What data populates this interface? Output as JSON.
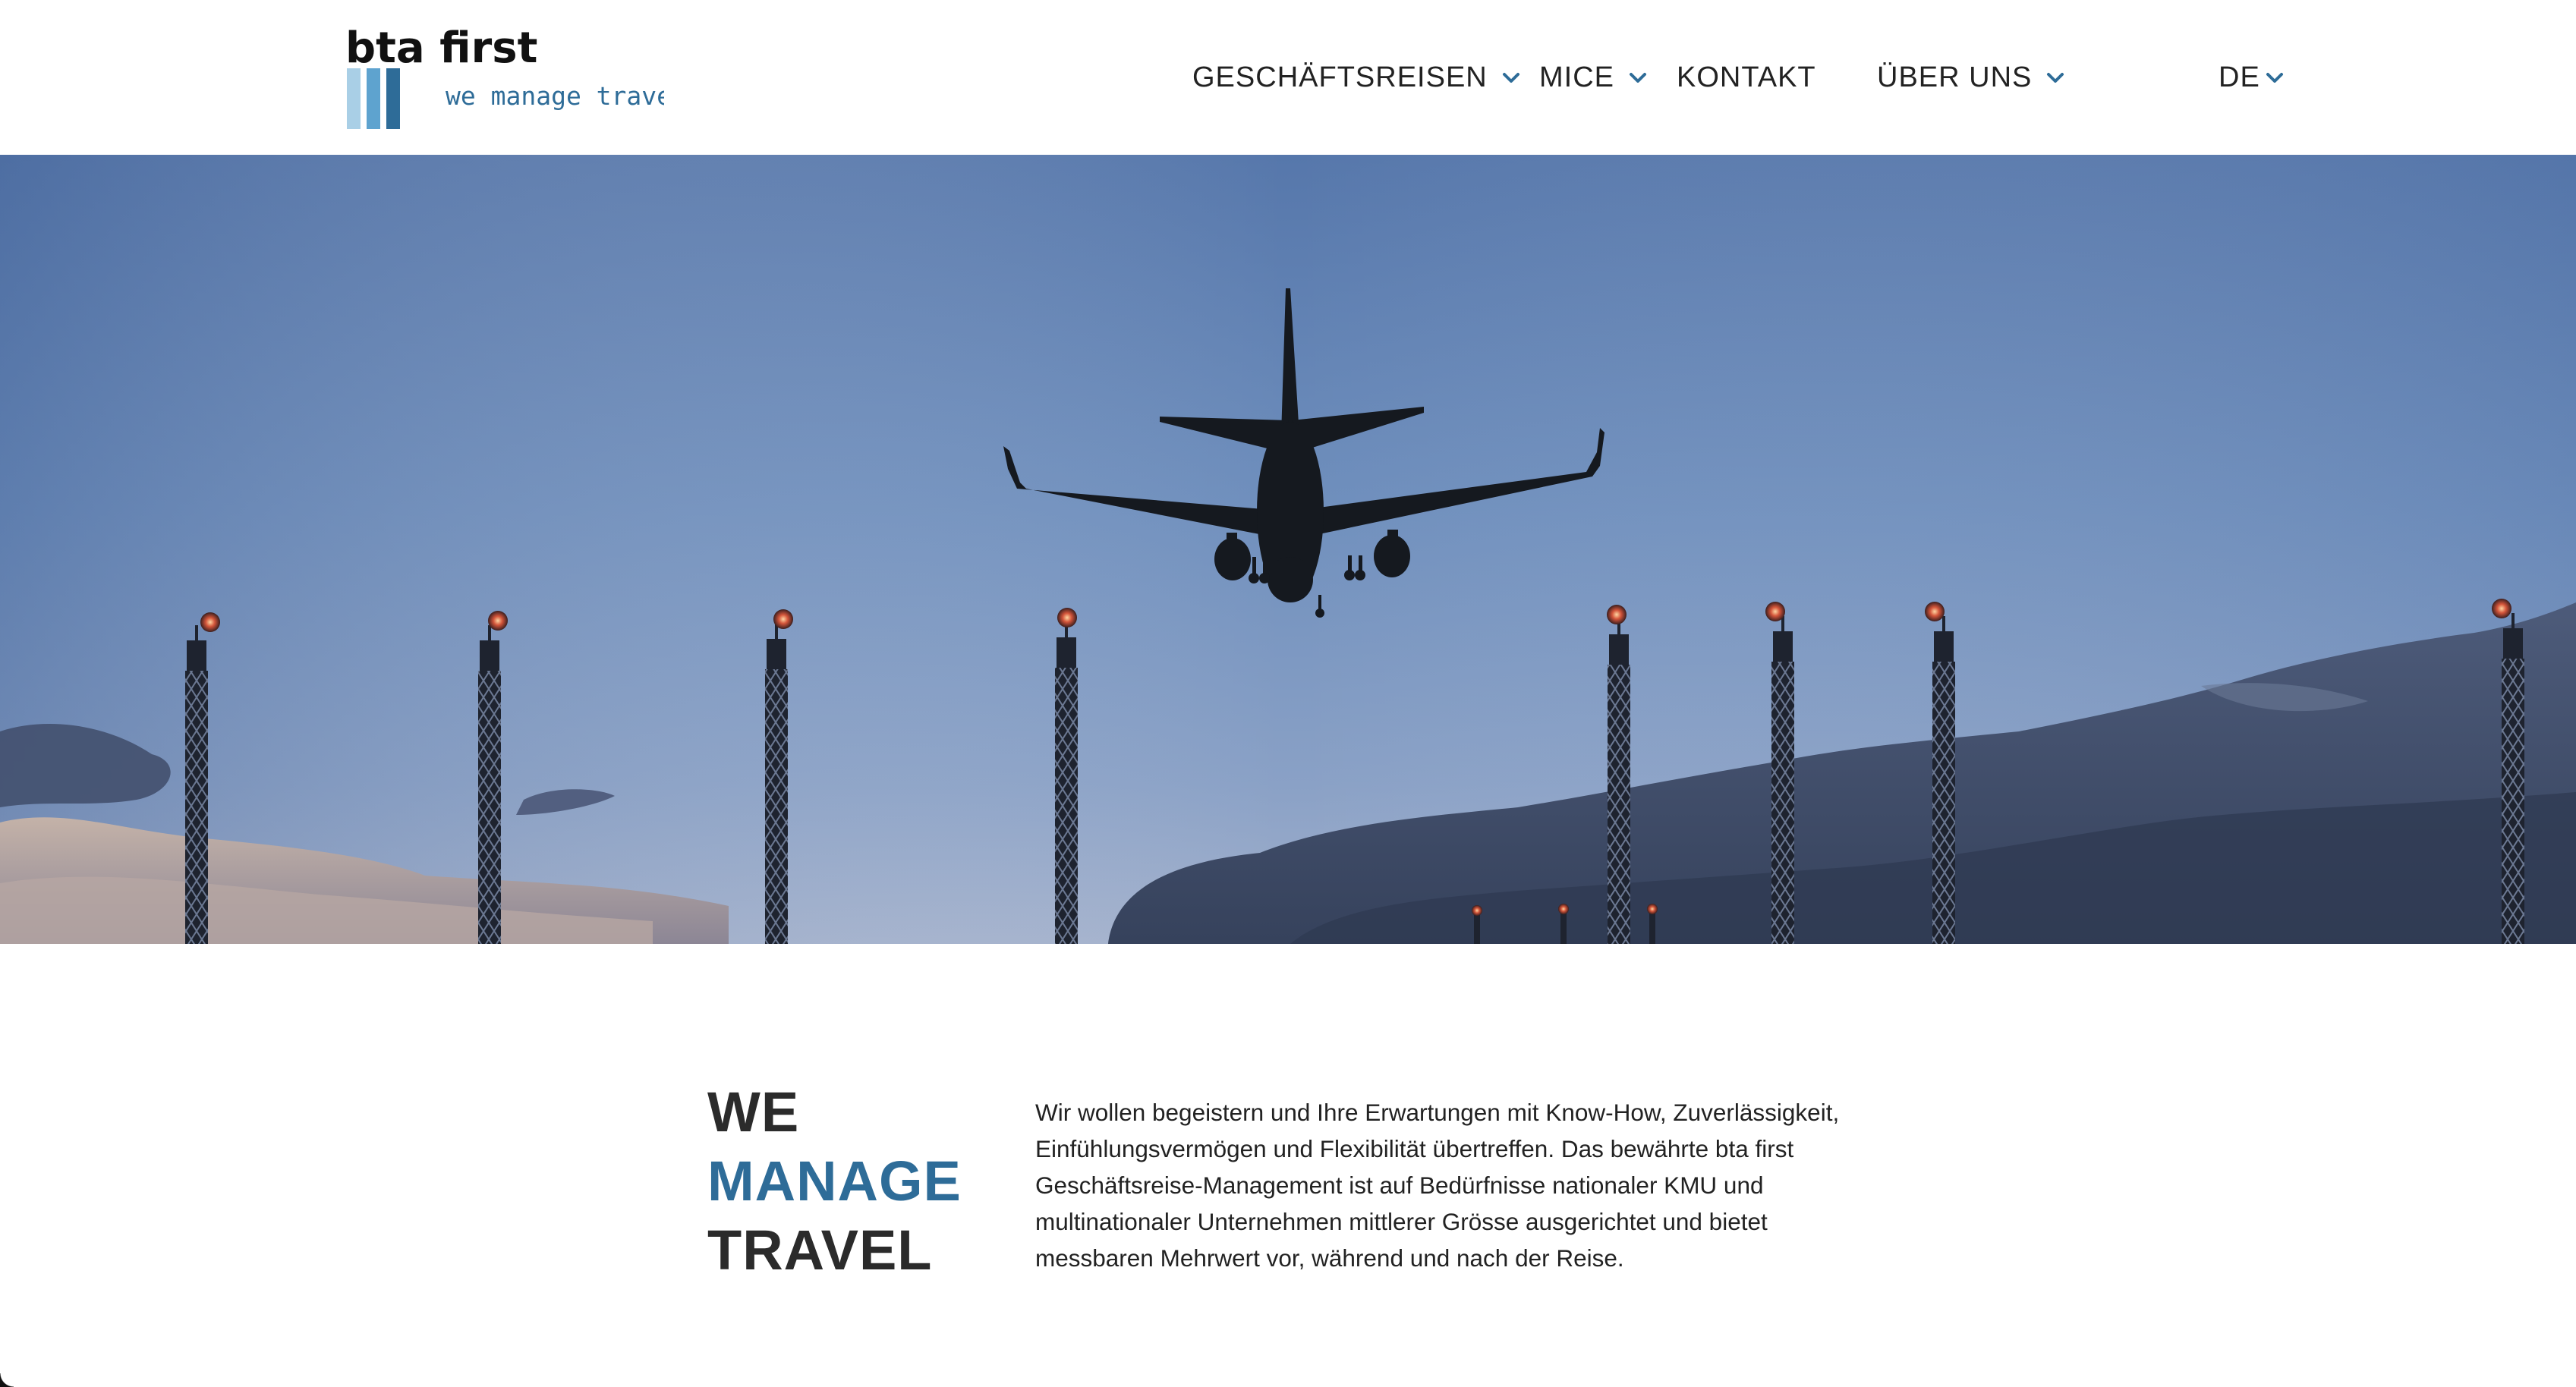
{
  "brand": {
    "name": "bta first",
    "tagline": "we manage travel",
    "colors": {
      "blue": "#2e6c98",
      "light_blue": "#a9cfe6",
      "mid_blue": "#5ea3cf",
      "dark_text": "#2b2b2b"
    }
  },
  "nav": {
    "items": [
      {
        "label": "GESCHÄFTSREISEN",
        "has_dropdown": true
      },
      {
        "label": "MICE",
        "has_dropdown": true
      },
      {
        "label": "KONTAKT",
        "has_dropdown": false
      },
      {
        "label": "ÜBER UNS",
        "has_dropdown": true
      }
    ],
    "language": {
      "label": "DE",
      "has_dropdown": true
    },
    "dropdown_icon": "chevron-down-icon"
  },
  "hero": {
    "image": "airplane-landing-over-approach-lights-at-dusk"
  },
  "intro": {
    "heading": {
      "line1": "WE",
      "line2": "MANAGE",
      "line3": "TRAVEL"
    },
    "text": "Wir wollen begeistern und Ihre Erwartungen mit Know-How, Zuverlässigkeit, Einfühlungsvermögen und Flexibilität übertreffen. Das bewährte bta first Geschäftsreise-Management ist auf Bedürfnisse nationaler KMU und multinationaler Unternehmen mittlerer Grösse ausgerichtet und bietet messbaren Mehrwert vor, während und nach der Reise."
  }
}
